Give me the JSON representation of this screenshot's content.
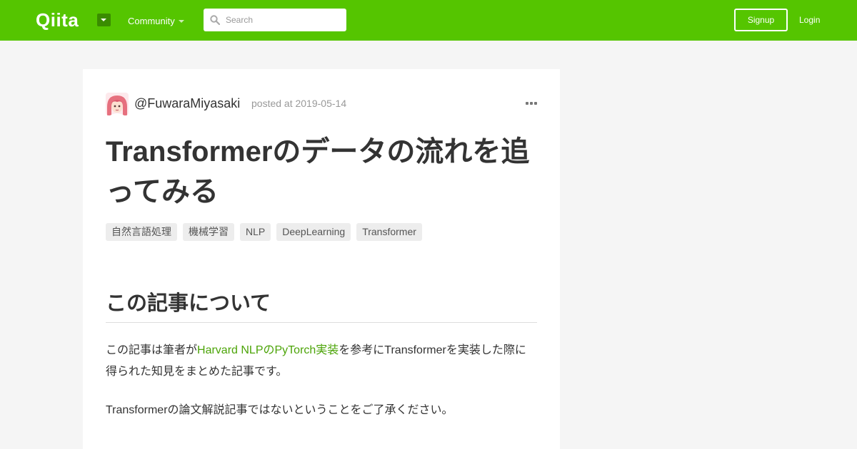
{
  "header": {
    "logo": "Qiita",
    "community_label": "Community",
    "search_placeholder": "Search",
    "signup_label": "Signup",
    "login_label": "Login"
  },
  "article": {
    "author": "@FuwaraMiyasaki",
    "posted_at": "posted at 2019-05-14",
    "title": "Transformerのデータの流れを追ってみる",
    "tags": [
      "自然言語処理",
      "機械学習",
      "NLP",
      "DeepLearning",
      "Transformer"
    ],
    "section_heading": "この記事について",
    "para1_before": "この記事は筆者が",
    "para1_link": "Harvard NLPのPyTorch実装",
    "para1_after": "を参考にTransformerを実装した際に得られた知見をまとめた記事です。",
    "para2": "Transformerの論文解説記事ではないということをご了承ください。"
  },
  "colors": {
    "brand": "#55c500",
    "link": "#4ca408"
  }
}
